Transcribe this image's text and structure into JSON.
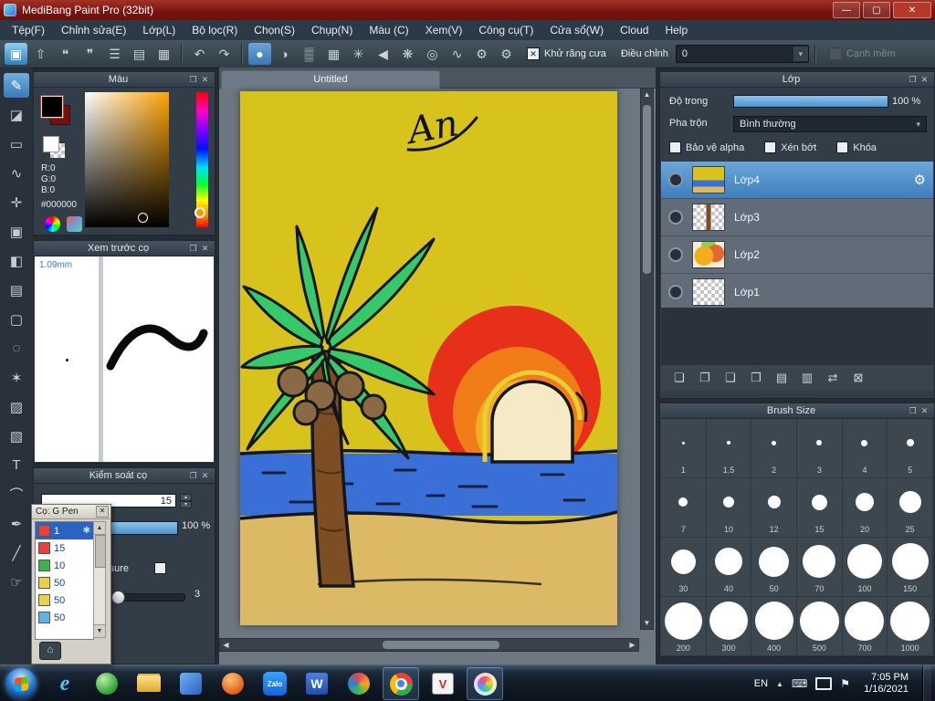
{
  "window": {
    "title": "MediBang Paint Pro (32bit)",
    "controls": {
      "minimize": "—",
      "maximize": "▢",
      "close": "✕"
    }
  },
  "icons": {
    "popout": "❐",
    "close": "✕",
    "gear": "⚙",
    "caret_down": "▾",
    "spin_up": "▴",
    "spin_down": "▾",
    "star": "✱",
    "scroll_up": "▲",
    "scroll_down": "▼",
    "scroll_left": "◀",
    "scroll_right": "▶",
    "tray_expand": "▲",
    "flag": "⚑",
    "keyboard": "⌨",
    "home": "⌂",
    "check": "✕"
  },
  "menu": {
    "items": [
      "Tệp(F)",
      "Chỉnh sửa(E)",
      "Lớp(L)",
      "Bộ lọc(R)",
      "Chọn(S)",
      "Chụp(N)",
      "Màu (C)",
      "Xem(V)",
      "Công cụ(T)",
      "Cửa sổ(W)",
      "Cloud",
      "Help"
    ]
  },
  "toolbar": {
    "icons": [
      {
        "name": "save-icon",
        "glyph": "▣",
        "variant": "primary"
      },
      {
        "name": "export-icon",
        "glyph": "⇧"
      },
      {
        "name": "chat-icon",
        "glyph": "❝"
      },
      {
        "name": "notes-icon",
        "glyph": "❞"
      },
      {
        "name": "list-icon",
        "glyph": "☰"
      },
      {
        "name": "panel-icon",
        "glyph": "▤"
      },
      {
        "name": "panel-edit-icon",
        "glyph": "▦"
      },
      {
        "type": "sep"
      },
      {
        "name": "undo-icon",
        "glyph": "↶"
      },
      {
        "name": "redo-icon",
        "glyph": "↷"
      },
      {
        "type": "sep"
      },
      {
        "name": "brush-circle-icon",
        "glyph": "●",
        "selected": true
      },
      {
        "name": "gradient-circle-icon",
        "glyph": "◑"
      },
      {
        "name": "screentone-icon",
        "glyph": "▒"
      },
      {
        "name": "grid-icon",
        "glyph": "▦"
      },
      {
        "name": "pattern-icon",
        "glyph": "✳"
      },
      {
        "name": "prev-icon",
        "glyph": "◀"
      },
      {
        "name": "snowflake-icon",
        "glyph": "❋"
      },
      {
        "name": "concentric-icon",
        "glyph": "◎"
      },
      {
        "name": "curve-icon",
        "glyph": "∿"
      },
      {
        "name": "brush-gear-icon",
        "glyph": "⚙"
      },
      {
        "name": "settings-gear-icon",
        "glyph": "⚙"
      }
    ],
    "antialias_label": "Khử răng cưa",
    "adjust_label": "Điều chỉnh",
    "adjust_value": "0",
    "soft_edge_label": "Cạnh mềm"
  },
  "tools": [
    {
      "name": "brush-tool",
      "glyph": "✎",
      "selected": true
    },
    {
      "name": "eraser-tool",
      "glyph": "◪"
    },
    {
      "name": "rectangle-tool",
      "glyph": "▭"
    },
    {
      "name": "airbrush-tool",
      "glyph": "∿"
    },
    {
      "name": "move-tool",
      "glyph": "✛"
    },
    {
      "name": "fill-rect-tool",
      "glyph": "▣"
    },
    {
      "name": "bucket-tool",
      "glyph": "◧"
    },
    {
      "name": "gradient-tool",
      "glyph": "▤"
    },
    {
      "name": "select-rect-tool",
      "glyph": "▢"
    },
    {
      "name": "select-ellipse-tool",
      "glyph": "◌"
    },
    {
      "name": "magic-wand-tool",
      "glyph": "✶"
    },
    {
      "name": "select-pen-tool",
      "glyph": "▨"
    },
    {
      "name": "select-eraser-tool",
      "glyph": "▧"
    },
    {
      "name": "text-tool",
      "glyph": "T"
    },
    {
      "name": "lasso-tool",
      "glyph": "⌒"
    },
    {
      "name": "eyedropper-tool",
      "glyph": "✒"
    },
    {
      "name": "slice-tool",
      "glyph": "╱"
    },
    {
      "name": "hand-tool",
      "glyph": "☞"
    }
  ],
  "panels": {
    "color": {
      "title": "Màu",
      "r_label": "R:0",
      "g_label": "G:0",
      "b_label": "B:0",
      "hex_label": "#000000"
    },
    "brush_preview": {
      "title": "Xem trước cọ",
      "size_label": "1.09mm"
    },
    "brush_control": {
      "title": "Kiểm soát cọ",
      "size_value": "15",
      "opacity_value": "100 %",
      "pressure_label": "Pressure",
      "pressure_value": "3"
    },
    "brush_list_popup": {
      "title": "Cọ: G Pen",
      "items": [
        {
          "size": "1",
          "swatch": "#e8413c",
          "selected": true
        },
        {
          "size": "15",
          "swatch": "#e8413c",
          "selected": false
        },
        {
          "size": "10",
          "swatch": "#3cb44a",
          "selected": false
        },
        {
          "size": "50",
          "swatch": "#e8d24a",
          "selected": false
        },
        {
          "size": "50",
          "swatch": "#e8d24a",
          "selected": false
        },
        {
          "size": "50",
          "swatch": "#5ab4e8",
          "selected": false
        }
      ]
    },
    "layer": {
      "title": "Lớp",
      "opacity_label": "Độ trong",
      "opacity_value": "100 %",
      "blend_label": "Pha trộn",
      "blend_value": "Bình thường",
      "checkboxes": [
        "Bảo vệ alpha",
        "Xén bớt",
        "Khóa"
      ],
      "layers": [
        {
          "name": "Lớp4",
          "selected": true,
          "thumb": "beach"
        },
        {
          "name": "Lớp3",
          "selected": false,
          "thumb": "trunk"
        },
        {
          "name": "Lớp2",
          "selected": false,
          "thumb": "color"
        },
        {
          "name": "Lớp1",
          "selected": false,
          "thumb": "empty"
        }
      ],
      "toolbar_icons": [
        {
          "name": "new-layer-icon",
          "glyph": "❏"
        },
        {
          "name": "duplicate-layer-icon",
          "glyph": "❐"
        },
        {
          "name": "merge-layer-icon",
          "glyph": "❑"
        },
        {
          "name": "add-layer-menu-icon",
          "glyph": "❒"
        },
        {
          "name": "layer-folder-icon",
          "glyph": "▤"
        },
        {
          "name": "copy-layer-icon",
          "glyph": "▥"
        },
        {
          "name": "transfer-layer-icon",
          "glyph": "⇄"
        },
        {
          "name": "delete-layer-icon",
          "glyph": "⊠"
        }
      ]
    },
    "brush_size": {
      "title": "Brush Size",
      "sizes": [
        "1",
        "1.5",
        "2",
        "3",
        "4",
        "5",
        "7",
        "10",
        "12",
        "15",
        "20",
        "25",
        "30",
        "40",
        "50",
        "70",
        "100",
        "150",
        "200",
        "300",
        "400",
        "500",
        "700",
        "1000"
      ]
    }
  },
  "canvas": {
    "tab_title": "Untitled",
    "signature": "An"
  },
  "taskbar": {
    "apps": [
      {
        "name": "internet-explorer",
        "glyph": "e"
      },
      {
        "name": "green-app",
        "glyph": ""
      },
      {
        "name": "folder",
        "glyph": ""
      },
      {
        "name": "media-app",
        "glyph": ""
      },
      {
        "name": "orange-app",
        "glyph": ""
      },
      {
        "name": "zalo",
        "glyph": "Zalo"
      },
      {
        "name": "word",
        "glyph": "W"
      },
      {
        "name": "paint-app",
        "glyph": ""
      },
      {
        "name": "chrome",
        "glyph": "",
        "active": true
      },
      {
        "name": "unikey",
        "glyph": "V"
      },
      {
        "name": "colorful-app",
        "glyph": "",
        "active": true
      }
    ],
    "tray_lang": "EN",
    "time": "7:05 PM",
    "date": "1/16/2021"
  }
}
